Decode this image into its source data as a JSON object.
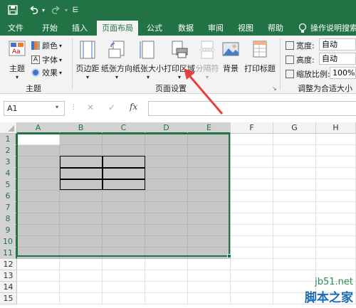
{
  "ribbon_tabs": [
    "文件",
    "开始",
    "插入",
    "页面布局",
    "公式",
    "数据",
    "审阅",
    "视图",
    "帮助"
  ],
  "active_tab": "页面布局",
  "tell_me": "操作说明搜索",
  "theme_group": {
    "big": "主题",
    "colors": "颜色",
    "fonts": "字体",
    "effects": "效果",
    "label": "主题"
  },
  "page_setup_group": {
    "buttons": [
      "页边距",
      "纸张方向",
      "纸张大小",
      "打印区域",
      "分隔符",
      "背景",
      "打印标题"
    ],
    "label": "页面设置"
  },
  "scale_group": {
    "width_label": "宽度:",
    "width_value": "自动",
    "height_label": "高度:",
    "height_value": "自动",
    "scale_label": "缩放比例:",
    "scale_value": "100%",
    "label": "调整为合适大小"
  },
  "formula_bar": {
    "name_box": "A1",
    "fx": "fx"
  },
  "columns": [
    "A",
    "B",
    "C",
    "D",
    "E",
    "F",
    "G",
    "H"
  ],
  "rows": [
    "1",
    "2",
    "3",
    "4",
    "5",
    "6",
    "7",
    "8",
    "9",
    "10",
    "11",
    "12",
    "13",
    "14",
    "15"
  ],
  "watermark": {
    "line1": "jb51.net",
    "line2": "脚本之家"
  },
  "colors": {
    "accent": "#217346",
    "selection_fill": "#c6c6c6",
    "arrow": "#e8413b"
  }
}
